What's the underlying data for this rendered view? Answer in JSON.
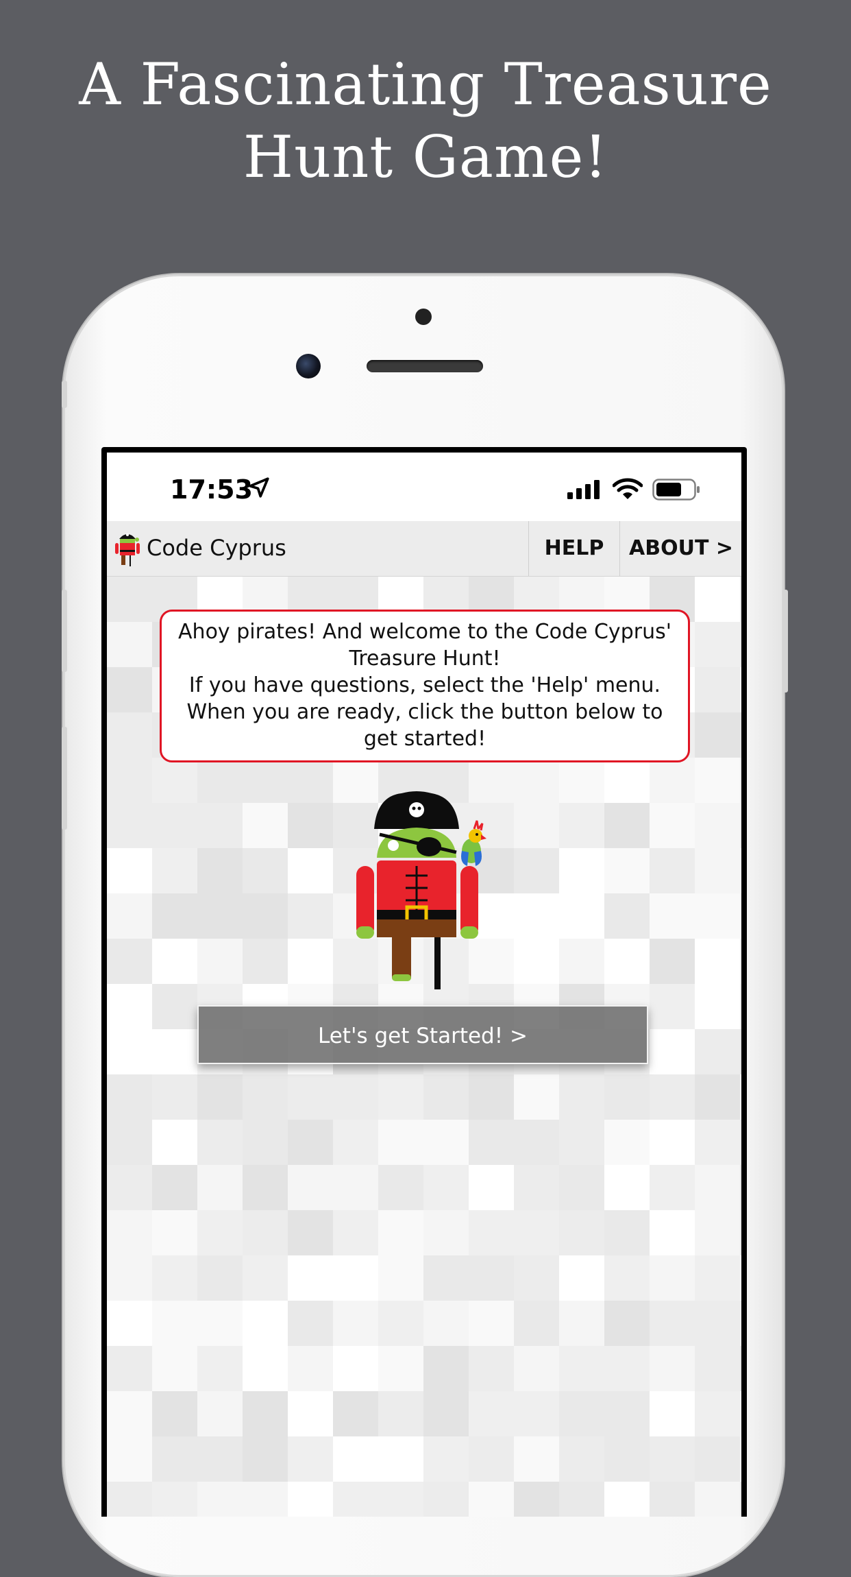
{
  "headline": {
    "line1": "A Fascinating Treasure",
    "line2": "Hunt Game!"
  },
  "status_bar": {
    "time": "17:53",
    "icons": [
      "location-arrow-icon",
      "cellular-signal-icon",
      "wifi-icon",
      "battery-icon"
    ]
  },
  "app_bar": {
    "logo_icon": "pirate-android-logo-icon",
    "title": "Code Cyprus",
    "menu_help": "HELP",
    "menu_about": "ABOUT >"
  },
  "welcome": {
    "line1": "Ahoy pirates! And welcome to the Code Cyprus'",
    "line2": "Treasure Hunt!",
    "line3": "If you have questions, select the 'Help' menu.",
    "line4": "When you are ready, click the button below to",
    "line5": "get started!"
  },
  "illustration": "pirate-android-with-parrot-icon",
  "start_button": "Let's get Started! >",
  "colors": {
    "page_background": "#5c5d62",
    "accent_red": "#e01524",
    "android_green": "#8dc63f",
    "button_grey": "#6e6e6e"
  }
}
